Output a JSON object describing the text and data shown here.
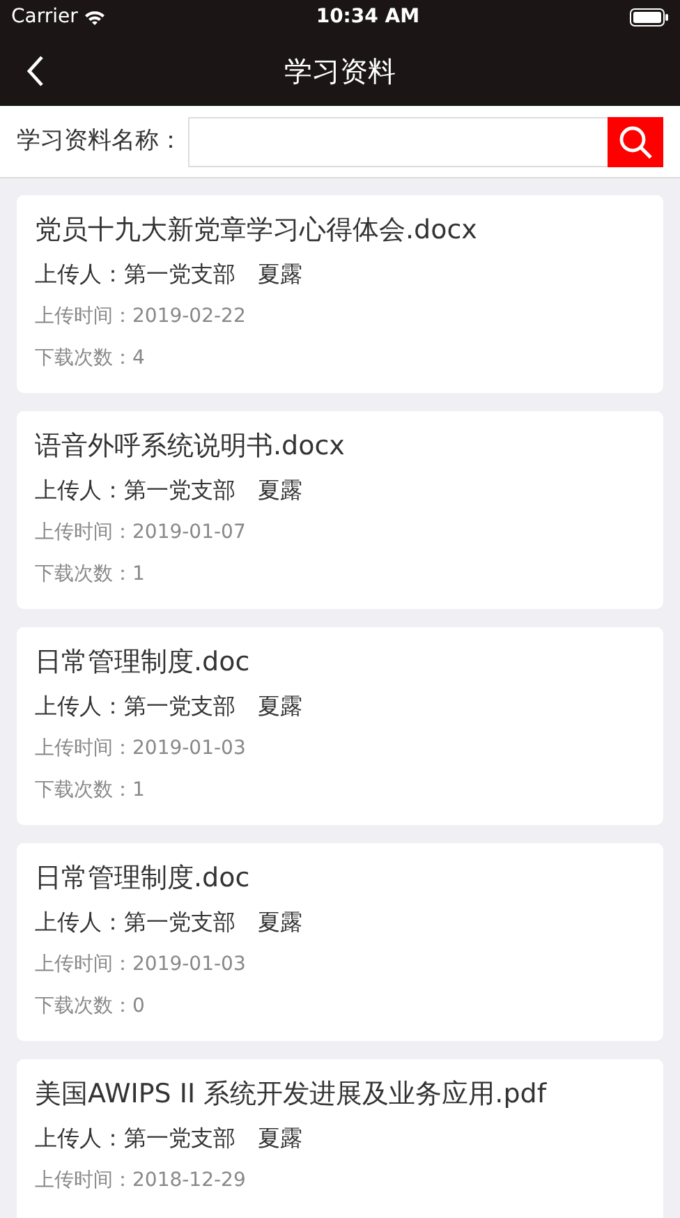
{
  "status_bar": {
    "carrier": "Carrier",
    "time": "10:34 AM"
  },
  "nav": {
    "title": "学习资料"
  },
  "search": {
    "label": "学习资料名称："
  },
  "documents": [
    {
      "title": "党员十九大新党章学习心得体会.docx",
      "uploader": "上传人：第一党支部　夏露",
      "upload_time": "上传时间：2019-02-22",
      "downloads": "下载次数：4"
    },
    {
      "title": "语音外呼系统说明书.docx",
      "uploader": "上传人：第一党支部　夏露",
      "upload_time": "上传时间：2019-01-07",
      "downloads": "下载次数：1"
    },
    {
      "title": "日常管理制度.doc",
      "uploader": "上传人：第一党支部　夏露",
      "upload_time": "上传时间：2019-01-03",
      "downloads": "下载次数：1"
    },
    {
      "title": "日常管理制度.doc",
      "uploader": "上传人：第一党支部　夏露",
      "upload_time": "上传时间：2019-01-03",
      "downloads": "下载次数：0"
    },
    {
      "title": "美国AWIPS II 系统开发进展及业务应用.pdf",
      "uploader": "上传人：第一党支部　夏露",
      "upload_time": "上传时间：2018-12-29"
    }
  ]
}
